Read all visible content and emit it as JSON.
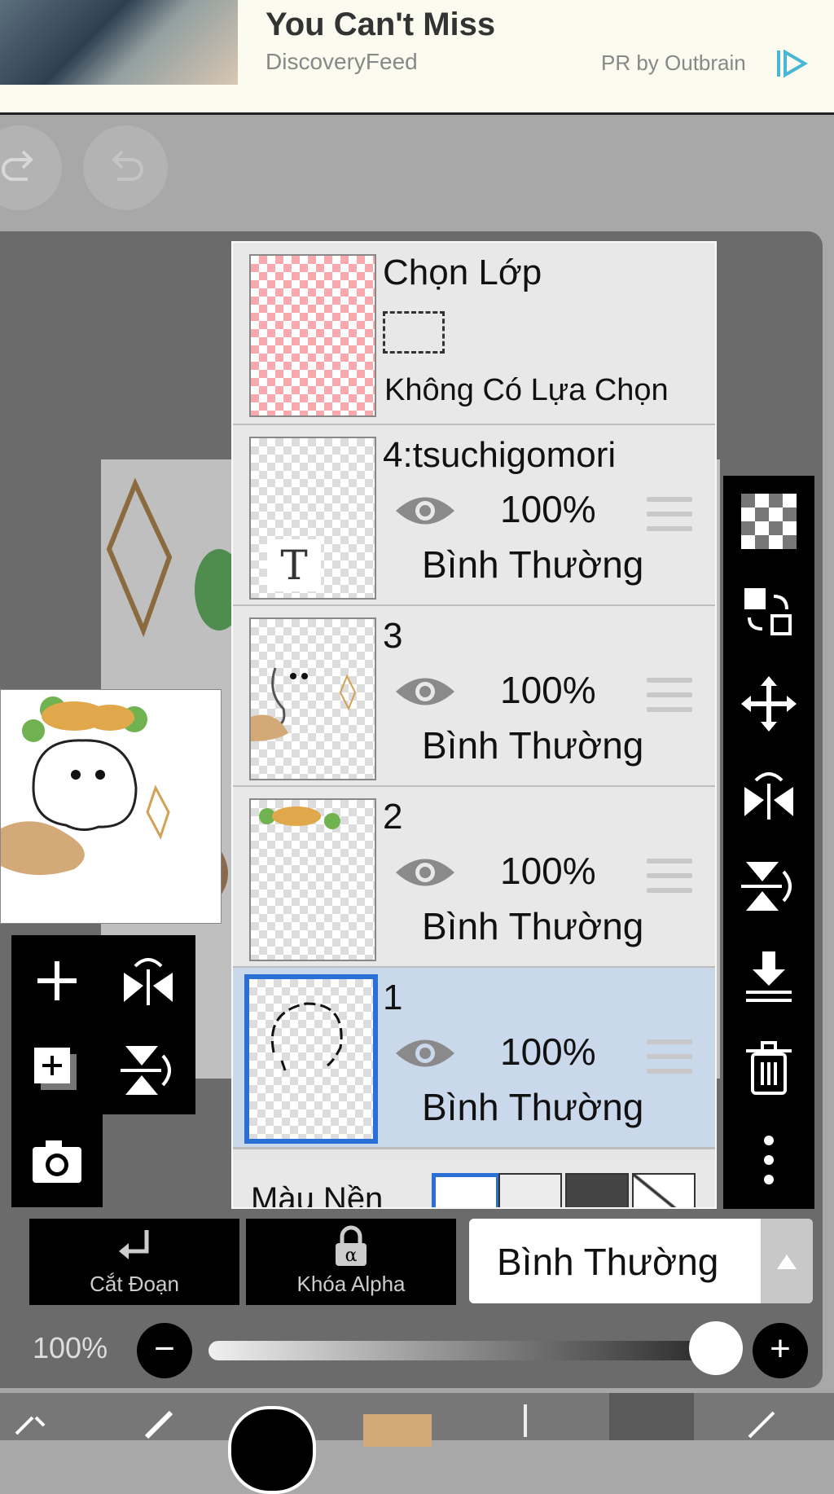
{
  "ad": {
    "title": "You Can't Miss",
    "source": "DiscoveryFeed",
    "pr_label": "PR by Outbrain"
  },
  "layer_panel": {
    "selection_layer": {
      "title": "Chọn Lớp",
      "status": "Không Có Lựa Chọn"
    },
    "layers": [
      {
        "name": "4:tsuchigomori",
        "opacity": "100%",
        "blend": "Bình Thường",
        "selected": false
      },
      {
        "name": "3",
        "opacity": "100%",
        "blend": "Bình Thường",
        "selected": false
      },
      {
        "name": "2",
        "opacity": "100%",
        "blend": "Bình Thường",
        "selected": false
      },
      {
        "name": "1",
        "opacity": "100%",
        "blend": "Bình Thường",
        "selected": true
      }
    ],
    "background_color_label": "Màu Nền"
  },
  "actions": {
    "clipping_label": "Cắt Đoạn",
    "alpha_lock_label": "Khóa Alpha",
    "blend_mode_value": "Bình Thường"
  },
  "opacity_slider": {
    "label": "100%",
    "value": 1.0
  },
  "colors": {
    "primary": "#000000",
    "secondary": "#d4a978",
    "selected_layer_bg": "#cad8ec",
    "selected_border": "#2a6fd6"
  },
  "icons": {
    "right_toolbar": [
      "checker-icon",
      "swap-icon",
      "move-icon",
      "flip-horizontal-icon",
      "flip-vertical-icon",
      "merge-down-icon",
      "trash-icon",
      "more-icon"
    ],
    "left_toolbar": [
      "add-layer-icon",
      "flip-h-icon",
      "duplicate-layer-icon",
      "flip-v-icon",
      "camera-icon"
    ]
  }
}
